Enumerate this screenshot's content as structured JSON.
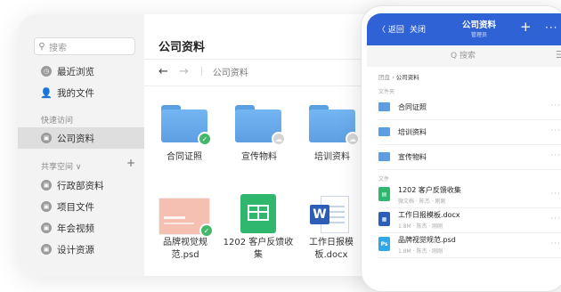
{
  "desktop": {
    "search_placeholder": "搜索",
    "nav": {
      "recent": "最近浏览",
      "my_files": "我的文件",
      "quick_access_label": "快速访问",
      "company_files": "公司资料",
      "shared_space_label": "共享空间 ∨",
      "shared_plus": "+",
      "admin_files": "行政部资料",
      "project_files": "项目文件",
      "annual_video": "年会视频",
      "design_resources": "设计资源"
    },
    "title": "公司资料",
    "toolbar": {
      "back": "←",
      "forward": "→",
      "path": "公司资料"
    },
    "items": [
      {
        "label": "合同证照"
      },
      {
        "label": "宣传物料"
      },
      {
        "label": "培训资料"
      },
      {
        "label": "品牌视觉规范.psd"
      },
      {
        "label": "1202 客户反馈收集"
      },
      {
        "label": "工作日报模板.docx"
      }
    ]
  },
  "phone": {
    "back": "〈 返回",
    "close": "关闭",
    "title": "公司资料",
    "subtitle": "管理员",
    "plus": "+",
    "more": "···",
    "search_placeholder": "Q 搜索",
    "breadcrumb_home": "团盘",
    "breadcrumb_current": "公司资料",
    "section_folders": "文件夹",
    "section_files": "文件",
    "folders": [
      "合同证照",
      "培训资料",
      "宣传物料"
    ],
    "files": [
      {
        "name": "1202 客户反馈收集",
        "meta": "微文档 · 陈杰 · 刚刚",
        "icon": "sheet",
        "color": "#2fb86d"
      },
      {
        "name": "工作日报模板.docx",
        "meta": "1.8M · 陈杰 · 刚刚",
        "icon": "word",
        "color": "#2b5eb4"
      },
      {
        "name": "品牌视觉规范.psd",
        "meta": "1.8M · 陈杰 · 刚刚",
        "icon": "Ps",
        "color": "#2fa8e8"
      }
    ]
  }
}
